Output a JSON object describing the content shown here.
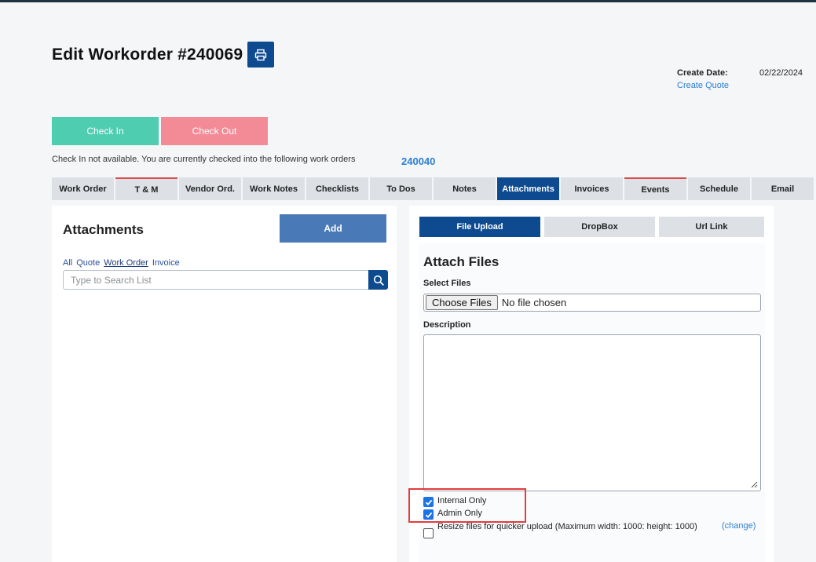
{
  "header": {
    "title": "Edit Workorder #240069",
    "print_icon": "printer-icon",
    "create_date_label": "Create Date:",
    "create_date_value": "02/22/2024",
    "create_quote_link": "Create Quote"
  },
  "checkin": {
    "check_in_label": "Check In",
    "check_out_label": "Check Out",
    "message": "Check In not available. You are currently checked into the following work orders",
    "workorder_link": "240040"
  },
  "tabs": [
    {
      "label": "Work Order"
    },
    {
      "label": "T & M"
    },
    {
      "label": "Vendor Ord."
    },
    {
      "label": "Work Notes"
    },
    {
      "label": "Checklists"
    },
    {
      "label": "To Dos"
    },
    {
      "label": "Notes"
    },
    {
      "label": "Attachments",
      "active": true
    },
    {
      "label": "Invoices"
    },
    {
      "label": "Events"
    },
    {
      "label": "Schedule"
    },
    {
      "label": "Email"
    }
  ],
  "attachments": {
    "title": "Attachments",
    "add_label": "Add",
    "filters": [
      "All",
      "Quote",
      "Work Order",
      "Invoice"
    ],
    "selected_filter": "Work Order",
    "search_placeholder": "Type to Search List",
    "search_icon": "search-icon"
  },
  "upload": {
    "sub_tabs": [
      "File Upload",
      "DropBox",
      "Url Link"
    ],
    "active_sub_tab": "File Upload",
    "title": "Attach Files",
    "select_files_label": "Select Files",
    "choose_files_label": "Choose Files",
    "no_file_text": "No file chosen",
    "description_label": "Description",
    "description_value": "",
    "internal_only_label": "Internal Only",
    "internal_only_checked": true,
    "admin_only_label": "Admin Only",
    "admin_only_checked": true,
    "resize_label": "Resize files for quicker upload (Maximum width: 1000: height: 1000)",
    "resize_checked": false,
    "change_link": "(change)"
  },
  "colors": {
    "primary": "#0d4a8f",
    "check_in": "#4ecdb0",
    "check_out": "#f28b96",
    "link": "#2a7fd4",
    "highlight": "#e53c3c"
  }
}
